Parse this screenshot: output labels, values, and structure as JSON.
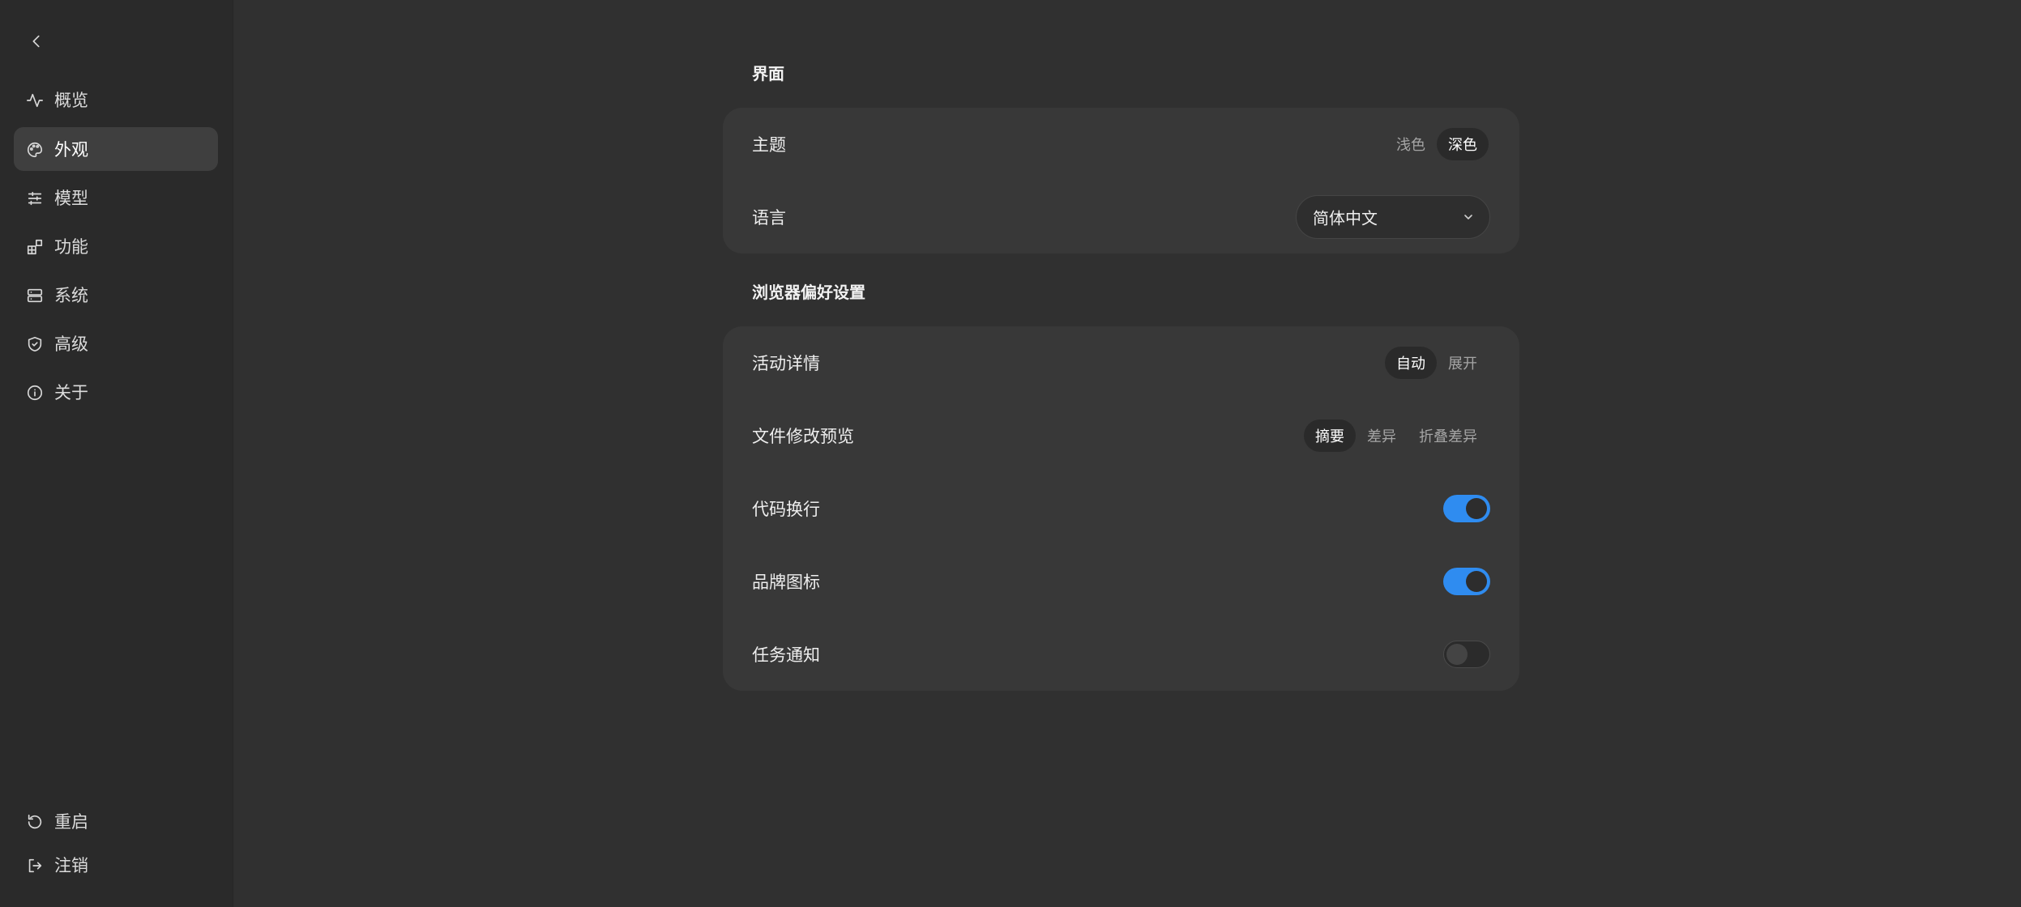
{
  "sidebar": {
    "items": [
      {
        "label": "概览",
        "icon": "activity-icon"
      },
      {
        "label": "外观",
        "icon": "palette-icon",
        "active": true
      },
      {
        "label": "模型",
        "icon": "sliders-icon"
      },
      {
        "label": "功能",
        "icon": "blocks-icon"
      },
      {
        "label": "系统",
        "icon": "server-icon"
      },
      {
        "label": "高级",
        "icon": "shield-icon"
      },
      {
        "label": "关于",
        "icon": "info-icon"
      }
    ],
    "bottom": [
      {
        "label": "重启",
        "icon": "restart-icon"
      },
      {
        "label": "注销",
        "icon": "logout-icon"
      }
    ]
  },
  "sections": {
    "interface": {
      "title": "界面",
      "theme": {
        "label": "主题",
        "options": [
          "浅色",
          "深色"
        ],
        "selected": "深色"
      },
      "language": {
        "label": "语言",
        "value": "简体中文"
      }
    },
    "browser": {
      "title": "浏览器偏好设置",
      "activity": {
        "label": "活动详情",
        "options": [
          "自动",
          "展开"
        ],
        "selected": "自动"
      },
      "filepreview": {
        "label": "文件修改预览",
        "options": [
          "摘要",
          "差异",
          "折叠差异"
        ],
        "selected": "摘要"
      },
      "codewrap": {
        "label": "代码换行",
        "on": true
      },
      "brandicon": {
        "label": "品牌图标",
        "on": true
      },
      "tasknotify": {
        "label": "任务通知",
        "on": false
      }
    }
  },
  "colors": {
    "accent": "#2f8cf0",
    "background": "#303030",
    "sidebar": "#2a2a2a",
    "card": "#383838"
  }
}
